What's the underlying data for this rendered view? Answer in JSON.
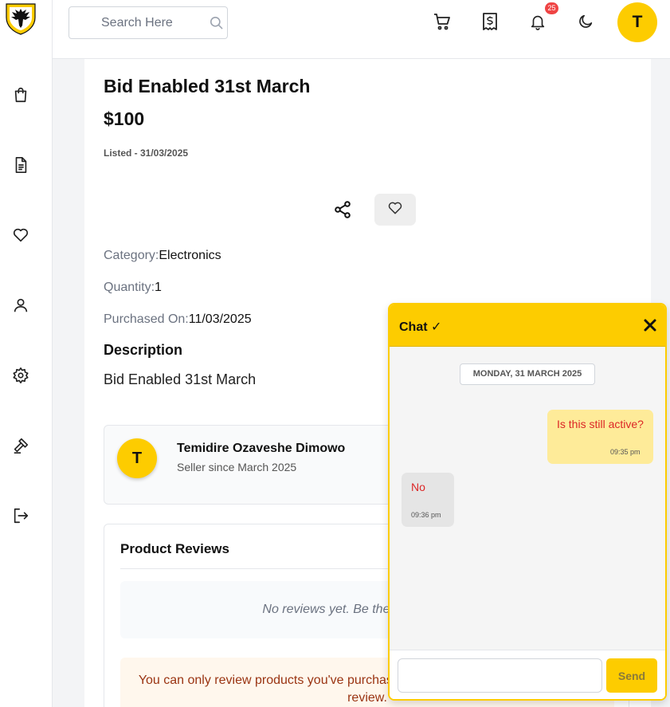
{
  "header": {
    "search_placeholder": "Search Here",
    "notification_count": "25",
    "avatar_initial": "T"
  },
  "sidebar": {
    "items": [
      {
        "icon": "shopping-bag-icon"
      },
      {
        "icon": "document-icon"
      },
      {
        "icon": "heart-icon"
      },
      {
        "icon": "user-icon"
      },
      {
        "icon": "gear-icon"
      },
      {
        "icon": "gavel-icon"
      },
      {
        "icon": "logout-icon"
      }
    ]
  },
  "product": {
    "title": "Bid Enabled 31st March",
    "price": "$100",
    "listed": "Listed - 31/03/2025",
    "category_label": "Category:",
    "category_value": "Electronics",
    "quantity_label": "Quantity:",
    "quantity_value": "1",
    "purchased_label": "Purchased On:",
    "purchased_value": "11/03/2025",
    "description_heading": "Description",
    "description": "Bid Enabled 31st March"
  },
  "seller": {
    "initial": "T",
    "name": "Temidire Ozaveshe Dimowo",
    "since": "Seller since March 2025"
  },
  "reviews": {
    "heading": "Product Reviews",
    "empty": "No reviews yet. Be the first to review!",
    "note": "You can only review products you've purchased. Purchase this product to leave a review."
  },
  "chat": {
    "title": "Chat ✓",
    "date": "MONDAY, 31 MARCH 2025",
    "messages": [
      {
        "text": "Is this still active?",
        "time": "09:35 pm",
        "direction": "outgoing"
      },
      {
        "text": "No",
        "time": "09:36 pm",
        "direction": "incoming"
      }
    ],
    "input_value": "",
    "send_label": "Send"
  },
  "colors": {
    "accent": "#fdcc00",
    "badge": "#ef4444",
    "message_text": "#dc2626"
  }
}
